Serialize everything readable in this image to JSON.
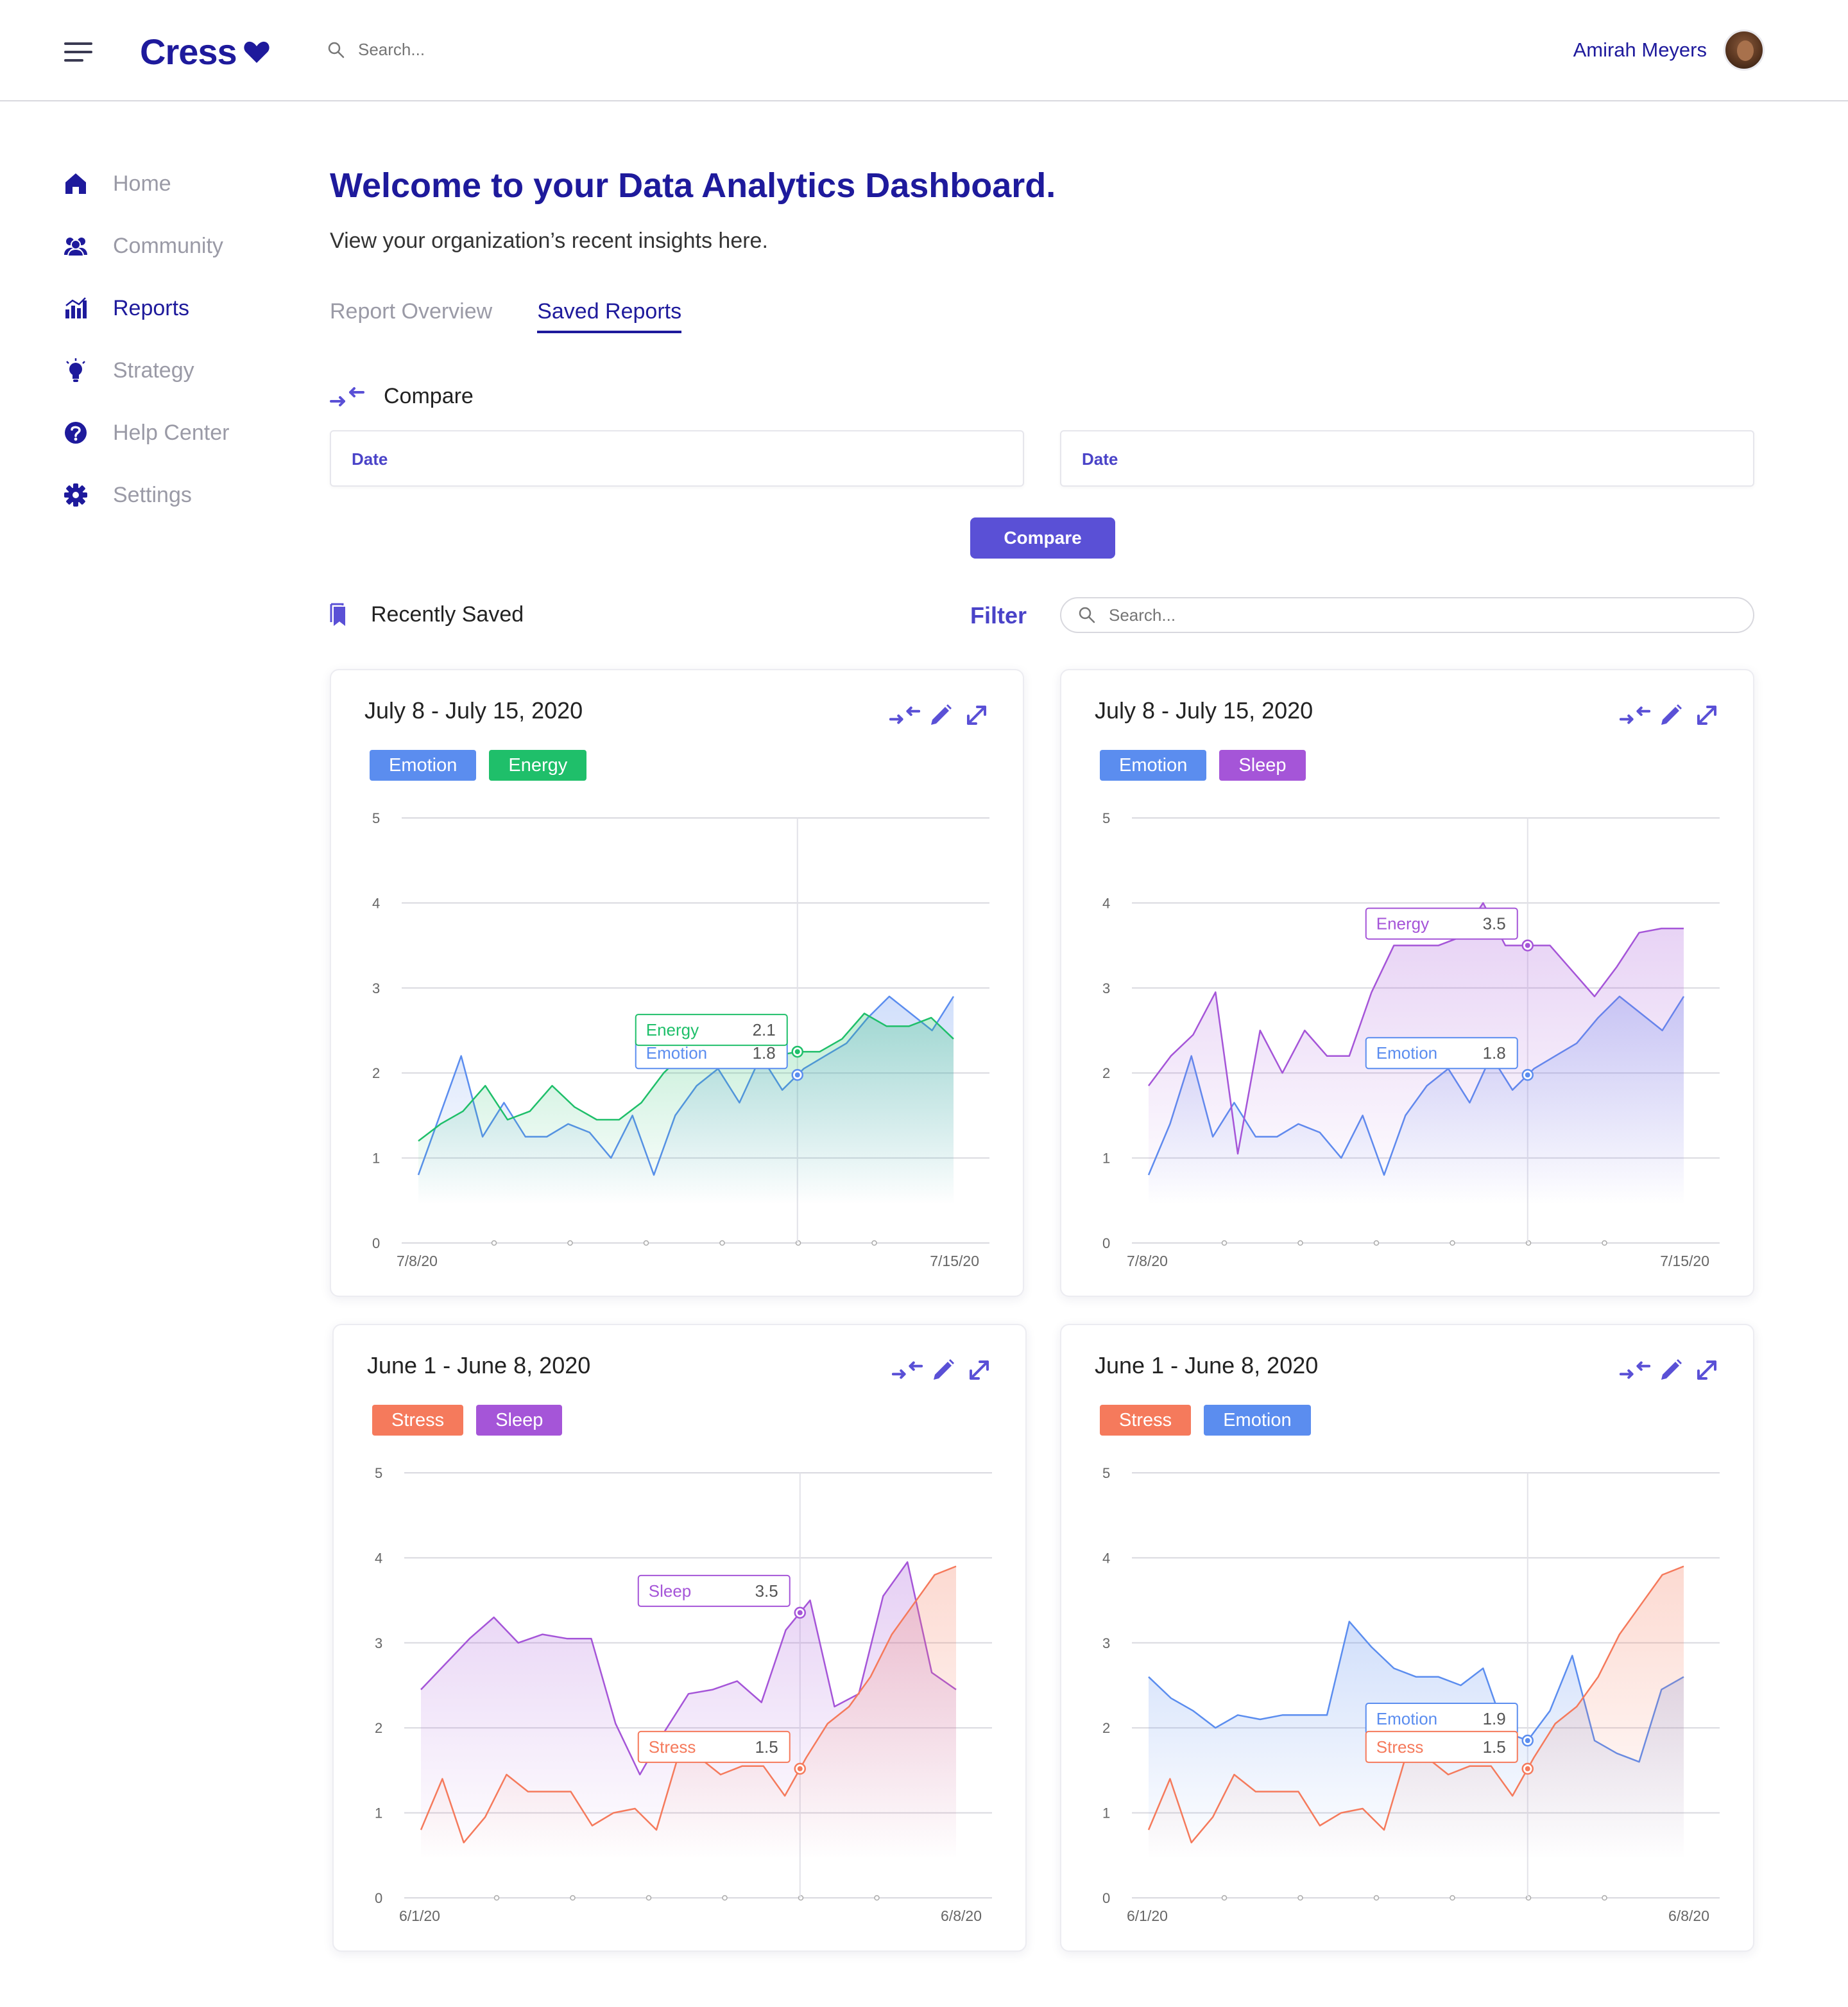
{
  "app": {
    "logo": "Cress",
    "search_placeholder": "Search...",
    "user_name": "Amirah Meyers"
  },
  "sidebar": {
    "items": [
      {
        "label": "Home",
        "icon": "home-icon",
        "active": false
      },
      {
        "label": "Community",
        "icon": "community-icon",
        "active": false
      },
      {
        "label": "Reports",
        "icon": "reports-icon",
        "active": true
      },
      {
        "label": "Strategy",
        "icon": "lightbulb-icon",
        "active": false
      },
      {
        "label": "Help Center",
        "icon": "help-icon",
        "active": false
      },
      {
        "label": "Settings",
        "icon": "gear-icon",
        "active": false
      }
    ]
  },
  "page": {
    "title": "Welcome to your Data Analytics Dashboard.",
    "subtitle": "View your organization’s recent insights here.",
    "tabs": [
      "Report Overview",
      "Saved Reports"
    ],
    "active_tab": "Saved Reports"
  },
  "compare": {
    "heading": "Compare",
    "date1_label": "Date",
    "date2_label": "Date",
    "button": "Compare"
  },
  "saved": {
    "heading": "Recently Saved",
    "filter": "Filter",
    "search_placeholder": "Search..."
  },
  "colors": {
    "brand": "#1e1a9c",
    "accent": "#5a50d6",
    "emotion": "#5b8def",
    "energy": "#1fbf6a",
    "sleep": "#a555d8",
    "stress": "#f57a5c"
  },
  "cards": [
    {
      "title": "July 8 - July 15, 2020",
      "tags": [
        {
          "label": "Emotion",
          "color": "#5b8def"
        },
        {
          "label": "Energy",
          "color": "#1fbf6a"
        }
      ]
    },
    {
      "title": "July 8 - July 15, 2020",
      "tags": [
        {
          "label": "Emotion",
          "color": "#5b8def"
        },
        {
          "label": "Sleep",
          "color": "#a555d8"
        }
      ]
    },
    {
      "title": "June 1 - June 8, 2020",
      "tags": [
        {
          "label": "Stress",
          "color": "#f57a5c"
        },
        {
          "label": "Sleep",
          "color": "#a555d8"
        }
      ]
    },
    {
      "title": "June 1 - June 8, 2020",
      "tags": [
        {
          "label": "Stress",
          "color": "#f57a5c"
        },
        {
          "label": "Emotion",
          "color": "#5b8def"
        }
      ]
    }
  ],
  "chart_data": [
    {
      "type": "area",
      "y_ticks": [
        0,
        1,
        2,
        3,
        4,
        5
      ],
      "ylim": [
        0,
        5
      ],
      "x_start_label": "7/8/20",
      "x_end_label": "7/15/20",
      "marker_index": 17,
      "series": [
        {
          "name": "Emotion",
          "color": "#5b8def",
          "values": [
            0.8,
            1.5,
            2.2,
            1.25,
            1.65,
            1.25,
            1.25,
            1.4,
            1.3,
            1.0,
            1.5,
            0.8,
            1.5,
            1.85,
            2.05,
            1.65,
            2.2,
            1.8,
            2.05,
            2.2,
            2.35,
            2.65,
            2.9,
            2.7,
            2.5,
            2.9
          ],
          "tooltip": {
            "label": "Emotion",
            "value": "1.8"
          }
        },
        {
          "name": "Energy",
          "color": "#1fbf6a",
          "values": [
            1.2,
            1.4,
            1.55,
            1.85,
            1.45,
            1.55,
            1.85,
            1.6,
            1.45,
            1.45,
            1.65,
            2.0,
            2.25,
            2.45,
            2.15,
            2.3,
            2.2,
            2.25,
            2.25,
            2.4,
            2.7,
            2.55,
            2.55,
            2.65,
            2.4
          ],
          "tooltip": {
            "label": "Energy",
            "value": "2.1"
          }
        }
      ]
    },
    {
      "type": "area",
      "y_ticks": [
        0,
        1,
        2,
        3,
        4,
        5
      ],
      "ylim": [
        0,
        5
      ],
      "x_start_label": "7/8/20",
      "x_end_label": "7/15/20",
      "marker_index": 17,
      "series": [
        {
          "name": "Emotion",
          "color": "#5b8def",
          "values": [
            0.8,
            1.4,
            2.2,
            1.25,
            1.65,
            1.25,
            1.25,
            1.4,
            1.3,
            1.0,
            1.5,
            0.8,
            1.5,
            1.85,
            2.05,
            1.65,
            2.2,
            1.8,
            2.05,
            2.2,
            2.35,
            2.65,
            2.9,
            2.7,
            2.5,
            2.9
          ],
          "tooltip": {
            "label": "Emotion",
            "value": "1.8"
          }
        },
        {
          "name": "Energy",
          "color": "#a555d8",
          "values": [
            1.85,
            2.2,
            2.45,
            2.95,
            1.05,
            2.5,
            2.0,
            2.5,
            2.2,
            2.2,
            2.95,
            3.5,
            3.5,
            3.5,
            3.6,
            4.0,
            3.5,
            3.5,
            3.5,
            3.2,
            2.9,
            3.25,
            3.65,
            3.7,
            3.7
          ],
          "tooltip": {
            "label": "Energy",
            "value": "3.5"
          }
        }
      ]
    },
    {
      "type": "area",
      "y_ticks": [
        0,
        1,
        2,
        3,
        4,
        5
      ],
      "ylim": [
        0,
        5
      ],
      "x_start_label": "6/1/20",
      "x_end_label": "6/8/20",
      "marker_index": 17,
      "series": [
        {
          "name": "Sleep",
          "color": "#a555d8",
          "values": [
            2.45,
            2.75,
            3.05,
            3.3,
            3.0,
            3.1,
            3.05,
            3.05,
            2.05,
            1.45,
            1.95,
            2.4,
            2.45,
            2.55,
            2.3,
            3.15,
            3.5,
            2.25,
            2.4,
            3.55,
            3.95,
            2.65,
            2.45
          ],
          "tooltip": {
            "label": "Sleep",
            "value": "3.5"
          }
        },
        {
          "name": "Stress",
          "color": "#f57a5c",
          "values": [
            0.8,
            1.4,
            0.65,
            0.95,
            1.45,
            1.25,
            1.25,
            1.25,
            0.85,
            1.0,
            1.05,
            0.8,
            1.65,
            1.65,
            1.45,
            1.55,
            1.55,
            1.2,
            1.65,
            2.05,
            2.25,
            2.6,
            3.1,
            3.45,
            3.8,
            3.9
          ],
          "tooltip": {
            "label": "Stress",
            "value": "1.5"
          }
        }
      ]
    },
    {
      "type": "area",
      "y_ticks": [
        0,
        1,
        2,
        3,
        4,
        5
      ],
      "ylim": [
        0,
        5
      ],
      "x_start_label": "6/1/20",
      "x_end_label": "6/8/20",
      "marker_index": 17,
      "series": [
        {
          "name": "Emotion",
          "color": "#5b8def",
          "values": [
            2.6,
            2.35,
            2.2,
            2.0,
            2.15,
            2.1,
            2.15,
            2.15,
            2.15,
            3.25,
            2.95,
            2.7,
            2.6,
            2.6,
            2.5,
            2.7,
            1.95,
            1.85,
            2.2,
            2.85,
            1.85,
            1.7,
            1.6,
            2.45,
            2.6
          ],
          "tooltip": {
            "label": "Emotion",
            "value": "1.9"
          }
        },
        {
          "name": "Stress",
          "color": "#f57a5c",
          "values": [
            0.8,
            1.4,
            0.65,
            0.95,
            1.45,
            1.25,
            1.25,
            1.25,
            0.85,
            1.0,
            1.05,
            0.8,
            1.65,
            1.65,
            1.45,
            1.55,
            1.55,
            1.2,
            1.65,
            2.05,
            2.25,
            2.6,
            3.1,
            3.45,
            3.8,
            3.9
          ],
          "tooltip": {
            "label": "Stress",
            "value": "1.5"
          }
        }
      ]
    }
  ]
}
